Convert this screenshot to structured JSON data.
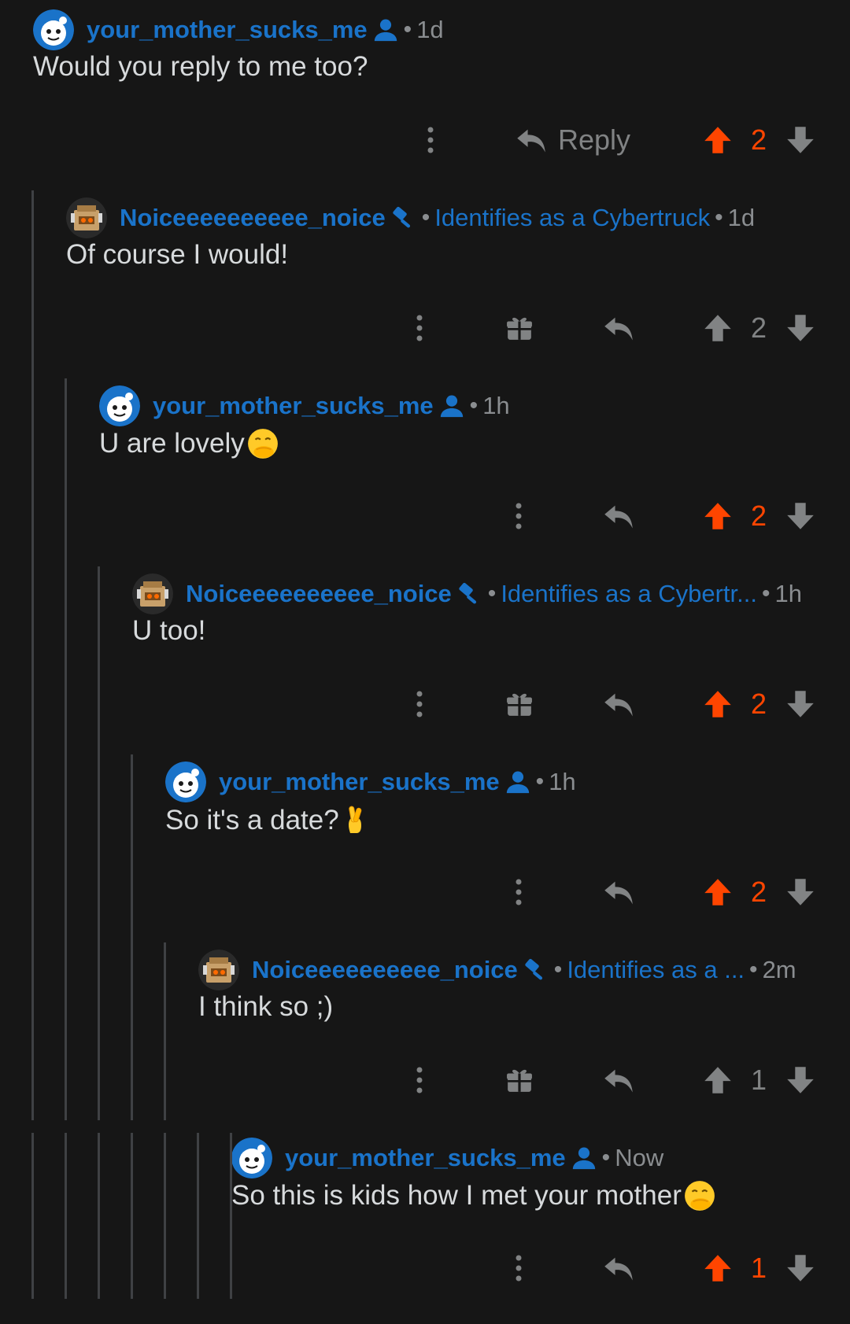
{
  "colors": {
    "background": "#161616",
    "username": "#1a73c9",
    "text": "#d7dadc",
    "meta": "#8a8d90",
    "upvote_active": "#ff4500",
    "icon_inactive": "#818384",
    "thread_line": "#3f4144"
  },
  "comments": [
    {
      "author": "your_mother_sucks_me",
      "badge_icon": "op-person-icon",
      "time": "1d",
      "body": "Would you reply to me too?",
      "reply_label": "Reply",
      "score": "2",
      "upvoted": true
    },
    {
      "author": "Noiceeeeeeeeee_noice",
      "badge_icon": "moderator-icon",
      "flair": "Identifies as a Cybertruck",
      "time": "1d",
      "body": "Of course I would!",
      "score": "2",
      "upvoted": false
    },
    {
      "author": "your_mother_sucks_me",
      "badge_icon": "op-person-icon",
      "time": "1h",
      "body": "U are lovely",
      "emoji": "hand-over-mouth-emoji",
      "score": "2",
      "upvoted": true
    },
    {
      "author": "Noiceeeeeeeeee_noice",
      "badge_icon": "moderator-icon",
      "flair": "Identifies as a Cybertr...",
      "time": "1h",
      "body": "U too!",
      "score": "2",
      "upvoted": true
    },
    {
      "author": "your_mother_sucks_me",
      "badge_icon": "op-person-icon",
      "time": "1h",
      "body": "So it's a date?",
      "emoji": "crossed-fingers-emoji",
      "score": "2",
      "upvoted": true
    },
    {
      "author": "Noiceeeeeeeeee_noice",
      "badge_icon": "moderator-icon",
      "flair": "Identifies as a ...",
      "time": "2m",
      "body": "I think so ;)",
      "score": "1",
      "upvoted": false
    },
    {
      "author": "your_mother_sucks_me",
      "badge_icon": "op-person-icon",
      "time": "Now",
      "body": "So this is kids how I met your mother",
      "emoji": "hand-over-mouth-emoji",
      "score": "1",
      "upvoted": true
    }
  ]
}
